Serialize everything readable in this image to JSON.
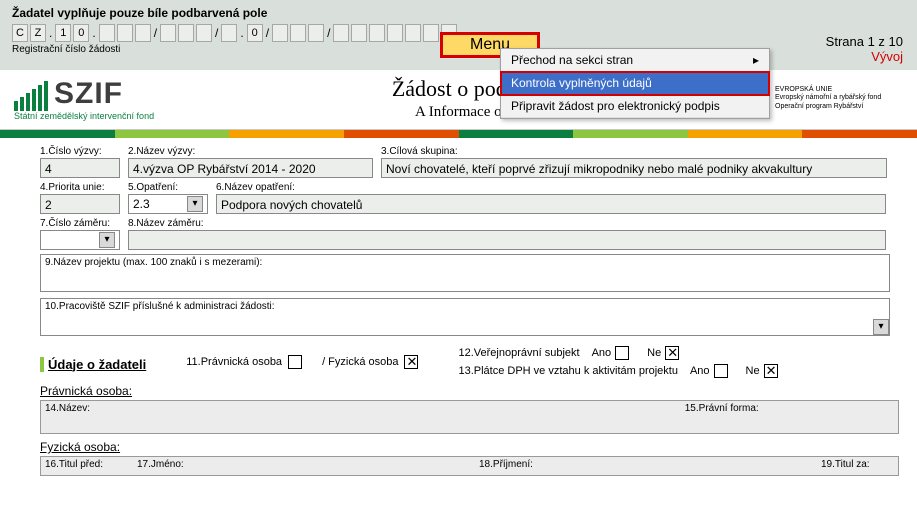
{
  "topbar": {
    "instruction": "Žadatel vyplňuje pouze bíle podbarvená pole",
    "reg_prefix": [
      "C",
      "Z",
      "1",
      "0",
      "",
      "",
      "",
      "",
      "",
      "0",
      "",
      "",
      "",
      "",
      "",
      "",
      "",
      "",
      "",
      "",
      "",
      ""
    ],
    "reg_label": "Registrační číslo žádosti",
    "menu_label": "Menu",
    "page_label": "Strana 1 z 10",
    "dev_label": "Vývoj"
  },
  "menu": {
    "items": [
      {
        "label": "Přechod na sekci stran",
        "arrow": "▸"
      },
      {
        "label": "Kontrola vyplněných údajů"
      },
      {
        "label": "Připravit žádost pro elektronický podpis"
      }
    ]
  },
  "header": {
    "brand": "SZIF",
    "brand_sub": "Státní zemědělský intervenční fond",
    "title": "Žádost o podporu z (",
    "subtitle": "A Informace o žadateli",
    "eu_line1": "EVROPSKÁ UNIE",
    "eu_line2": "Evropský námořní a rybářský fond",
    "eu_line3": "Operační program Rybářství"
  },
  "fields": {
    "f1_label": "1.Číslo výzvy:",
    "f1_val": "4",
    "f2_label": "2.Název výzvy:",
    "f2_val": "4.výzva OP Rybářství 2014 - 2020",
    "f3_label": "3.Cílová skupina:",
    "f3_val": "Noví chovatelé, kteří poprvé zřizují mikropodniky nebo malé podniky akvakultury",
    "f4_label": "4.Priorita unie:",
    "f4_val": "2",
    "f5_label": "5.Opatření:",
    "f5_val": "2.3",
    "f6_label": "6.Název opatření:",
    "f6_val": "Podpora nových chovatelů",
    "f7_label": "7.Číslo záměru:",
    "f7_val": "",
    "f8_label": "8.Název záměru:",
    "f8_val": "",
    "f9_label": "9.Název projektu (max. 100 znaků i s mezerami):",
    "f10_label": "10.Pracoviště SZIF příslušné k administraci žádosti:"
  },
  "udaje": {
    "section": "Údaje o žadateli",
    "f11_label": "11.Právnická osoba",
    "f11b_label": "/  Fyzická osoba",
    "f12_label": "12.Veřejnoprávní subjekt",
    "f13_label": "13.Plátce DPH ve vztahu k aktivitám projektu",
    "ano": "Ano",
    "ne": "Ne",
    "pravnicka": "Právnická osoba:",
    "f14_label": "14.Název:",
    "f15_label": "15.Právní forma:",
    "fyzicka": "Fyzická osoba:",
    "f16_label": "16.Titul před:",
    "f17_label": "17.Jméno:",
    "f18_label": "18.Příjmení:",
    "f19_label": "19.Titul za:"
  }
}
